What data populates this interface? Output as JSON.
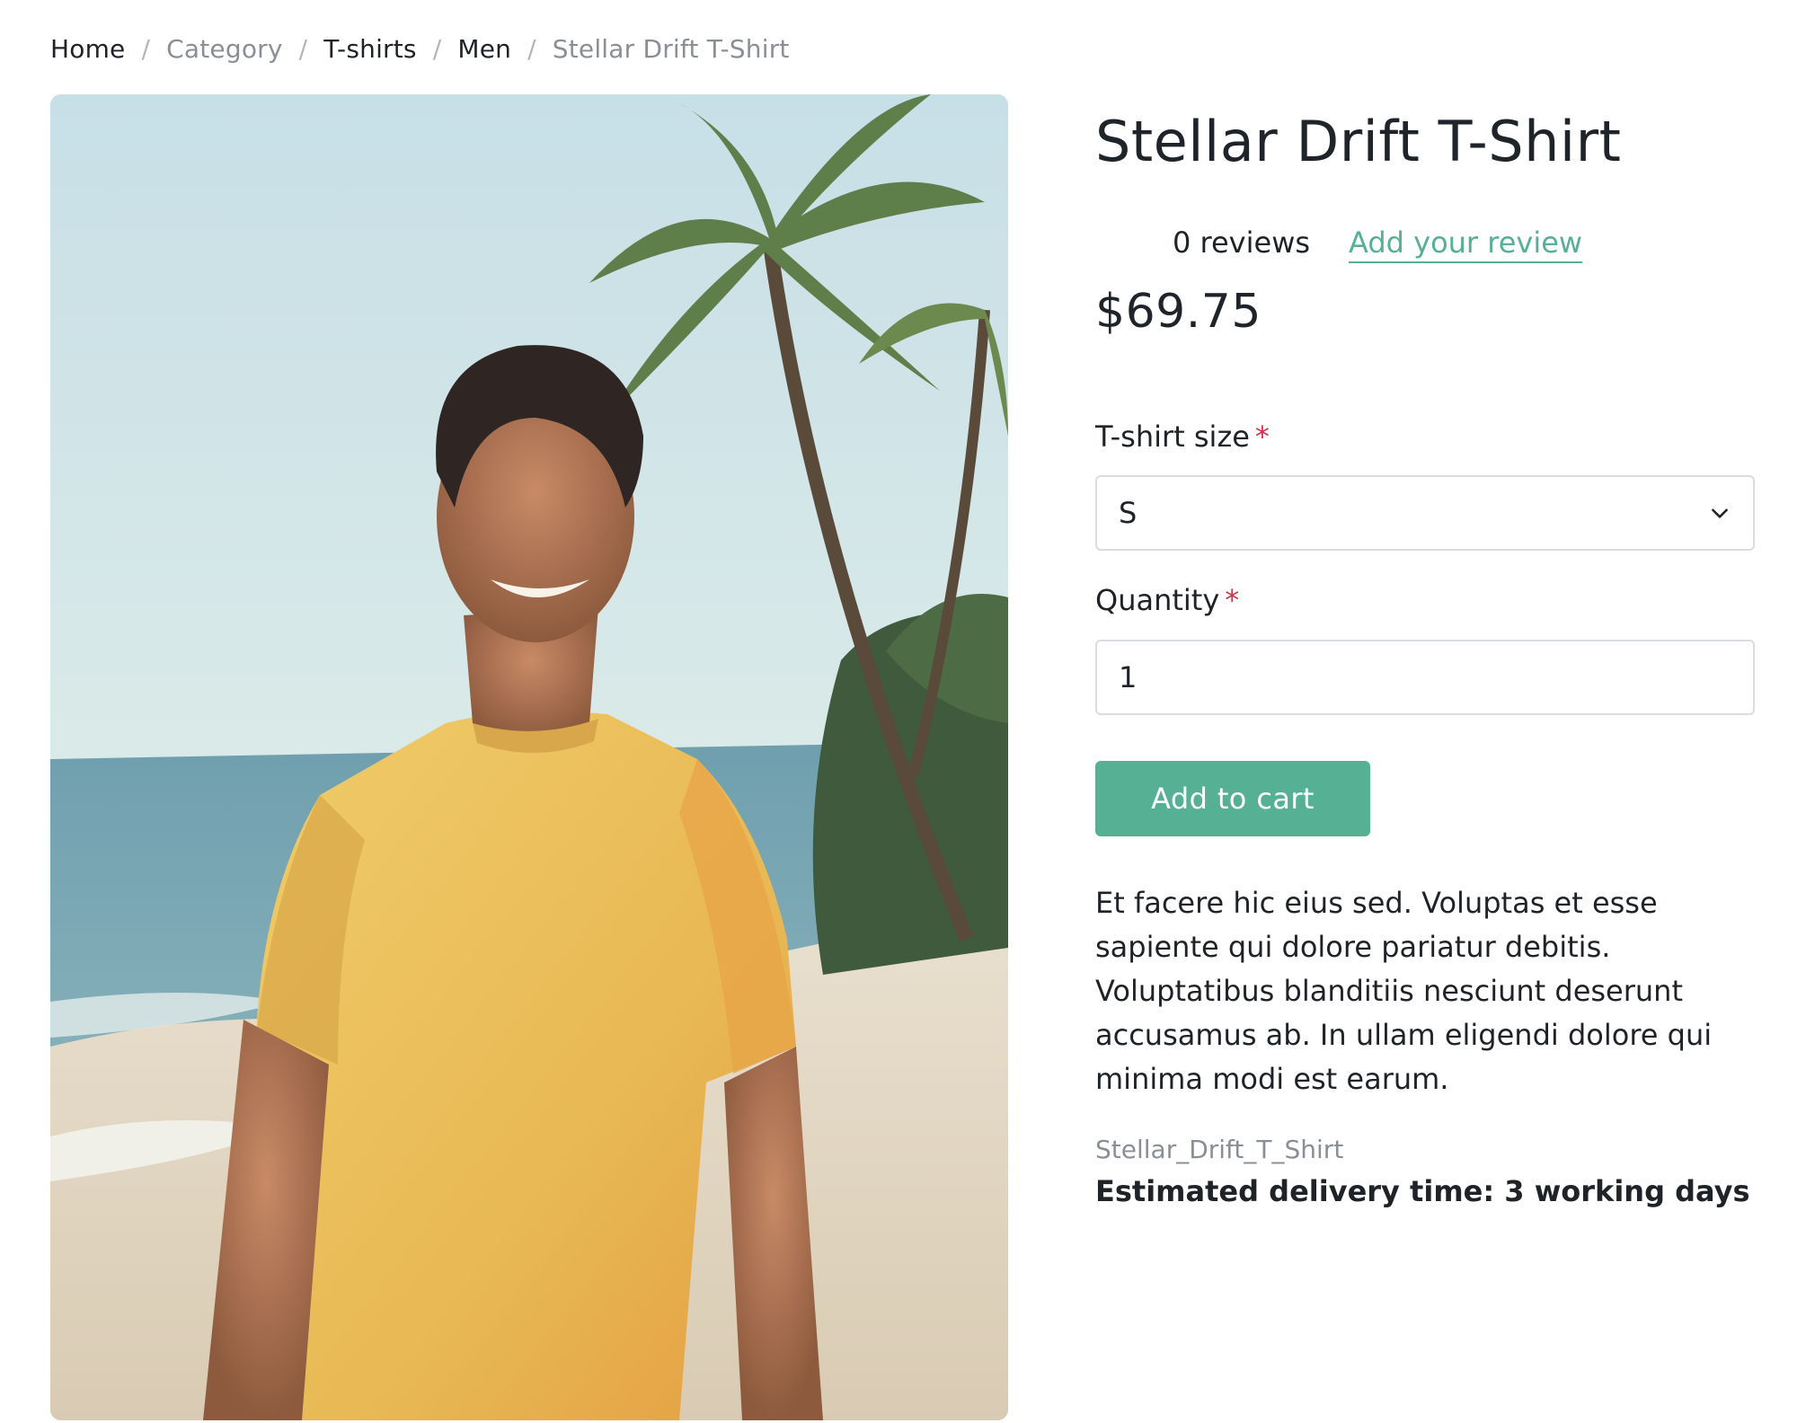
{
  "breadcrumb": [
    {
      "label": "Home",
      "muted": false
    },
    {
      "label": "Category",
      "muted": true
    },
    {
      "label": "T-shirts",
      "muted": false
    },
    {
      "label": "Men",
      "muted": false
    },
    {
      "label": "Stellar Drift T-Shirt",
      "muted": true
    }
  ],
  "breadcrumb_separator": "/",
  "product": {
    "title": "Stellar Drift T-Shirt",
    "review_count": "0 reviews",
    "add_review": "Add your review",
    "price": "$69.75",
    "image_alt": "Smiling man in a yellow t-shirt on a beach with palm trees",
    "description": "Et facere hic eius sed. Voluptas et esse sapiente qui dolore pariatur debitis. Voluptatibus blanditiis nesciunt deserunt accusamus ab. In ullam eligendi dolore qui minima modi est earum.",
    "sku": "Stellar_Drift_T_Shirt",
    "delivery": "Estimated delivery time: 3 working days"
  },
  "form": {
    "size_label": "T-shirt size",
    "size_value": "S",
    "quantity_label": "Quantity",
    "quantity_value": "1",
    "required_mark": "*",
    "add_to_cart": "Add to cart"
  },
  "colors": {
    "accent": "#56b194",
    "link": "#55b095",
    "required": "#d0324a",
    "muted_text": "#8a8f96"
  },
  "icons": {
    "select_chevron": "chevron-down-icon"
  }
}
